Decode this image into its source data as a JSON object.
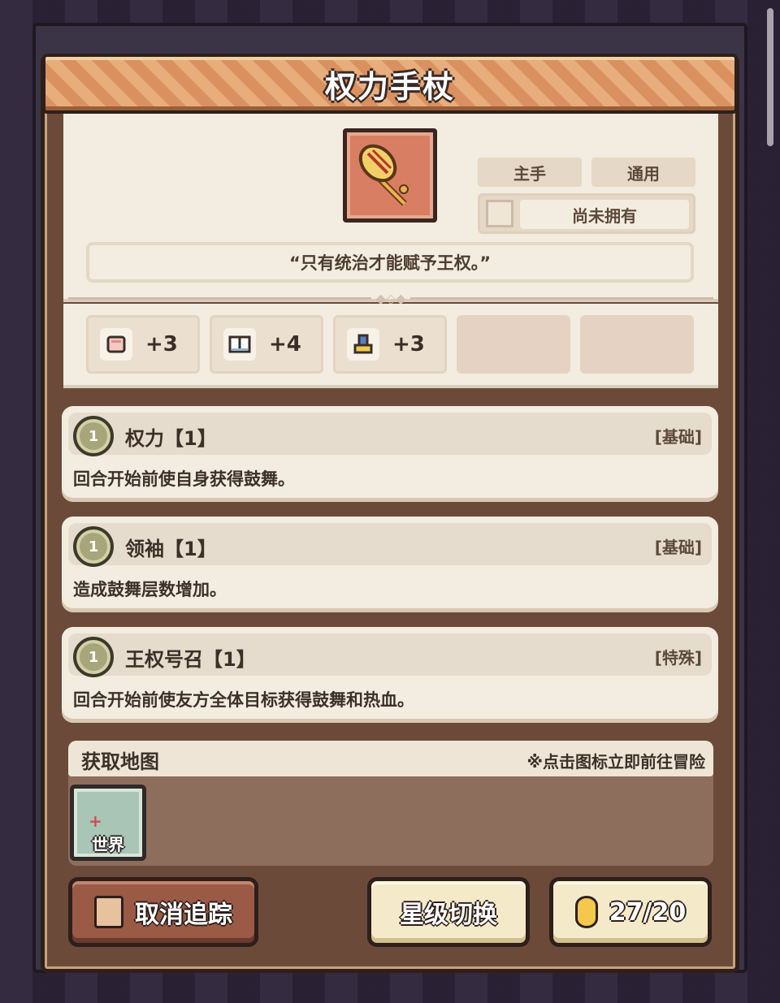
{
  "title": "权力手杖",
  "item": {
    "icon": "scepter-icon",
    "tags": [
      "主手",
      "通用"
    ],
    "ownership": "尚未拥有",
    "quote": "“只有统治才能赋予王权。”"
  },
  "stats": [
    {
      "icon": "fist-icon",
      "value": "+3"
    },
    {
      "icon": "book-icon",
      "value": "+4"
    },
    {
      "icon": "boot-icon",
      "value": "+3"
    }
  ],
  "skills": [
    {
      "level": "1",
      "name": "权力【1】",
      "type": "[基础]",
      "desc": "回合开始前使自身获得鼓舞。"
    },
    {
      "level": "1",
      "name": "领袖【1】",
      "type": "[基础]",
      "desc": "造成鼓舞层数增加。"
    },
    {
      "level": "1",
      "name": "王权号召【1】",
      "type": "[特殊]",
      "desc": "回合开始前使友方全体目标获得鼓舞和热血。"
    }
  ],
  "map": {
    "title": "获取地图",
    "hint": "※点击图标立即前往冒险",
    "tile_label": "世界"
  },
  "buttons": {
    "untrack": "取消追踪",
    "star_switch": "星级切换",
    "count": "27/20"
  },
  "colors": {
    "panel": "#6b4a3a",
    "card": "#f3ece0",
    "title_bar": "#dc9966",
    "item_bg": "#d87e63",
    "gem": "#f2c94c"
  }
}
